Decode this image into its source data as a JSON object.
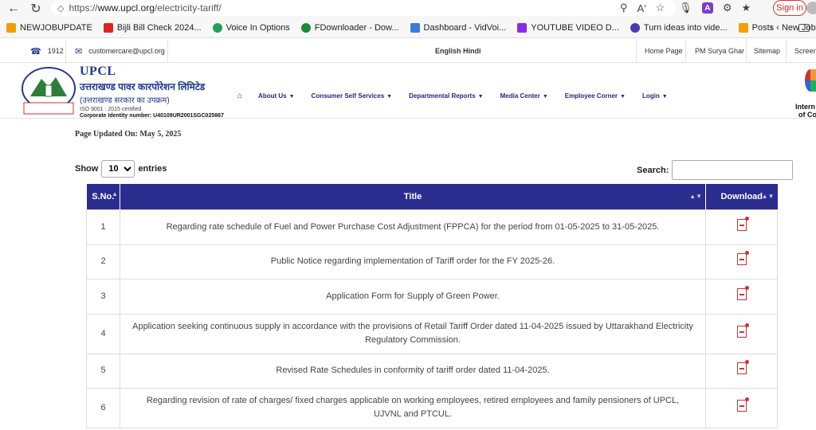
{
  "browser": {
    "url_proto": "https://",
    "url_host": "www.upcl.org",
    "url_path": "/electricity-tariff/",
    "signin": "Sign in",
    "bookmarks": [
      {
        "label": "NEWJOBUPDATE",
        "color": "#f0a000"
      },
      {
        "label": "Bijli Bill Check 2024...",
        "color": "#d22"
      },
      {
        "label": "Voice In Options",
        "color": "#2a9d5c"
      },
      {
        "label": "FDownloader - Dow...",
        "color": "#1a8a3a"
      },
      {
        "label": "Dashboard - VidVoi...",
        "color": "#3b7bd8"
      },
      {
        "label": "YOUTUBE VIDEO D...",
        "color": "#8a2be2"
      },
      {
        "label": "Turn ideas into vide...",
        "color": "#4a3ab0"
      },
      {
        "label": "Posts ‹ New Job Up...",
        "color": "#f0a000"
      }
    ]
  },
  "topbar": {
    "phone": "1912",
    "email": "customercare@upcl.org",
    "lang": "English Hindi",
    "links": [
      "Home Page",
      "PM Surya Ghar",
      "Sitemap",
      "Screen"
    ]
  },
  "header": {
    "abbr": "UPCL",
    "hindi_name": "उत्तराखण्ड पावर कारपोरेशन लिमिटेड",
    "hindi_sub": "(उत्तराखण्ड सरकार का उपक्रम)",
    "iso": "ISO 9001 : 2015 certified",
    "cin": "Corporate Identity number: U40109UR2001SGC025867",
    "menu": [
      "About Us",
      "Consumer Self Services",
      "Departmental Reports",
      "Media Center",
      "Employee Corner",
      "Login"
    ],
    "azadi_line1": "Intern",
    "azadi_line2": "of Co"
  },
  "page": {
    "updated": "Page Updated On: May 5, 2025",
    "show_label": "Show",
    "show_value": "10",
    "entries_label": "entries",
    "search_label": "Search:",
    "search_value": ""
  },
  "table": {
    "headers": [
      "S.No.",
      "Title",
      "Download"
    ],
    "rows": [
      {
        "sno": "1",
        "title": "Regarding rate schedule of Fuel and Power Purchase Cost Adjustment (FPPCA) for the period from 01-05-2025 to 31-05-2025."
      },
      {
        "sno": "2",
        "title": "Public Notice regarding implementation of Tariff order for the FY 2025-26."
      },
      {
        "sno": "3",
        "title": "Application Form for Supply of Green Power."
      },
      {
        "sno": "4",
        "title": "Application seeking continuous supply in accordance with the provisions of Retail Tariff Order dated 11-04-2025 issued by Uttarakhand Electricity Regulatory Commission."
      },
      {
        "sno": "5",
        "title": "Revised Rate Schedules in conformity of tariff order dated 11-04-2025."
      },
      {
        "sno": "6",
        "title": "Regarding revision of rate of charges/ fixed charges applicable on working employees, retired employees and family pensioners of UPCL, UJVNL and PTCUL."
      }
    ]
  }
}
